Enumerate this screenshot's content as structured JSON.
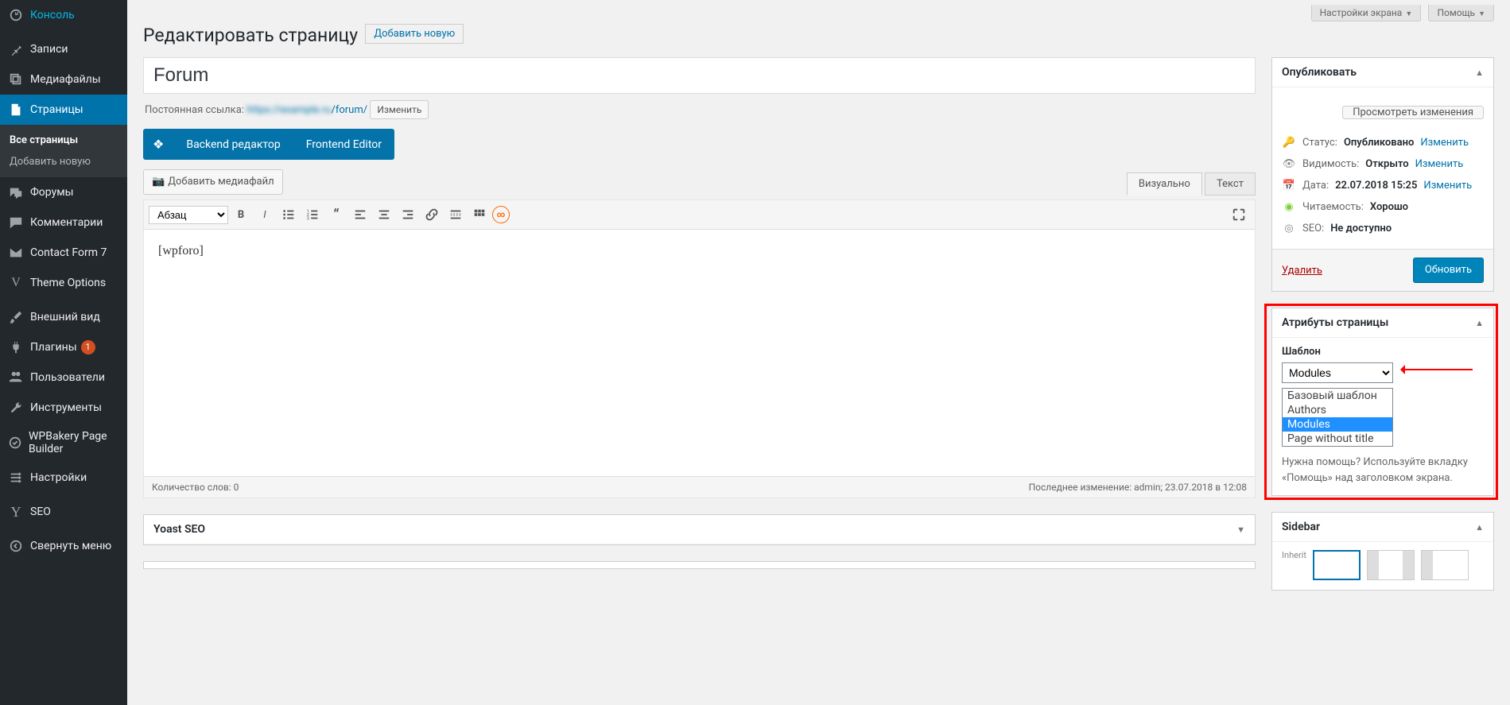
{
  "sidebar": {
    "items": [
      {
        "label": "Консоль"
      },
      {
        "label": "Записи"
      },
      {
        "label": "Медиафайлы"
      },
      {
        "label": "Страницы"
      },
      {
        "label": "Форумы"
      },
      {
        "label": "Комментарии"
      },
      {
        "label": "Contact Form 7"
      },
      {
        "label": "Theme Options"
      },
      {
        "label": "Внешний вид"
      },
      {
        "label": "Плагины"
      },
      {
        "label": "Пользователи"
      },
      {
        "label": "Инструменты"
      },
      {
        "label": "WPBakery Page Builder"
      },
      {
        "label": "Настройки"
      },
      {
        "label": "SEO"
      },
      {
        "label": "Свернуть меню"
      }
    ],
    "submenu": {
      "all": "Все страницы",
      "add": "Добавить новую"
    },
    "plugin_badge": "1"
  },
  "topbar": {
    "screen_options": "Настройки экрана",
    "help": "Помощь"
  },
  "heading": {
    "title": "Редактировать страницу",
    "add_new": "Добавить новую"
  },
  "title_input": "Forum",
  "permalink": {
    "label": "Постоянная ссылка:",
    "slug": "/forum/",
    "edit": "Изменить"
  },
  "vc": {
    "backend": "Backend редактор",
    "frontend": "Frontend Editor"
  },
  "media_button": "Добавить медиафайл",
  "editor": {
    "tab_visual": "Визуально",
    "tab_text": "Текст",
    "format_select": "Абзац",
    "content": "[wpforo]",
    "word_count_label": "Количество слов: ",
    "word_count": "0",
    "last_edit": "Последнее изменение: admin; 23.07.2018 в 12:08"
  },
  "yoast_box_title": "Yoast SEO",
  "publish": {
    "box_title": "Опубликовать",
    "preview": "Просмотреть изменения",
    "status_label": "Статус:",
    "status_value": "Опубликовано",
    "visibility_label": "Видимость:",
    "visibility_value": "Открыто",
    "date_label": "Дата:",
    "date_value": "22.07.2018 15:25",
    "edit_link": "Изменить",
    "readability_label": "Читаемость:",
    "readability_value": "Хорошо",
    "seo_label": "SEO:",
    "seo_value": "Не доступно",
    "delete": "Удалить",
    "update": "Обновить"
  },
  "attributes": {
    "box_title": "Атрибуты страницы",
    "template_label": "Шаблон",
    "selected": "Modules",
    "options": [
      "Базовый шаблон",
      "Authors",
      "Modules",
      "Page without title"
    ],
    "help": "Нужна помощь? Используйте вкладку «Помощь» над заголовком экрана."
  },
  "sidebar_box": {
    "title": "Sidebar"
  }
}
